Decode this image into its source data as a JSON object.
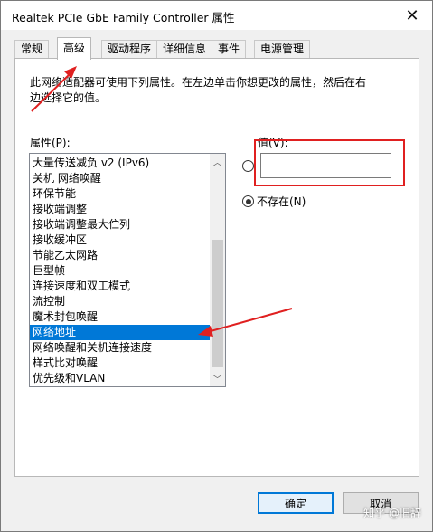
{
  "window": {
    "title": "Realtek PCIe GbE Family Controller 属性",
    "close_glyph": "✕"
  },
  "tabs": [
    {
      "label": "常规"
    },
    {
      "label": "高级",
      "active": true
    },
    {
      "label": "驱动程序"
    },
    {
      "label": "详细信息"
    },
    {
      "label": "事件"
    },
    {
      "label": "电源管理"
    }
  ],
  "advanced": {
    "description": "此网络适配器可使用下列属性。在左边单击你想更改的属性，然后在右边选择它的值。",
    "property_label": "属性(P):",
    "value_label": "值(V):",
    "value_input": "",
    "not_present_label": "不存在(N)",
    "selected_radio": "not_present",
    "properties": [
      "大量传送减负 v2 (IPv6)",
      "关机 网络唤醒",
      "环保节能",
      "接收端调整",
      "接收端调整最大伫列",
      "接收缓冲区",
      "节能乙太网路",
      "巨型帧",
      "连接速度和双工模式",
      "流控制",
      "魔术封包唤醒",
      "网络地址",
      "网络唤醒和关机连接速度",
      "样式比对唤醒",
      "优先级和VLAN"
    ],
    "selected_property": "网络地址"
  },
  "buttons": {
    "ok": "确定",
    "cancel": "取消"
  },
  "watermark": "知乎 @旧辞",
  "colors": {
    "selection": "#0078d7",
    "annotation": "#e02020"
  }
}
